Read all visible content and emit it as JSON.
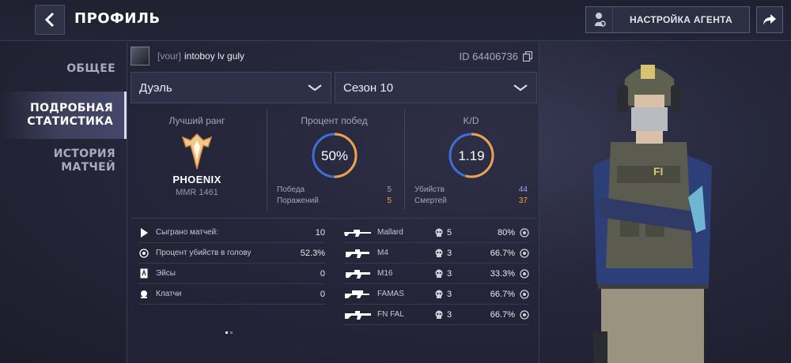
{
  "header": {
    "title": "ПРОФИЛЬ",
    "agent_button_label": "НАСТРОЙКА АГЕНТА"
  },
  "nav": {
    "items": [
      {
        "label": "ОБЩЕЕ",
        "active": false
      },
      {
        "label": "ПОДРОБНАЯ СТАТИСТИКА",
        "active": true
      },
      {
        "label": "ИСТОРИЯ МАТЧЕЙ",
        "active": false
      }
    ]
  },
  "user": {
    "clan": "[vour]",
    "nickname": "intoboy lv guly",
    "id_text": "ID 64406736"
  },
  "filters": {
    "mode": "Дуэль",
    "season": "Сезон 10"
  },
  "rank": {
    "title": "Лучший ранг",
    "name": "PHOENIX",
    "mmr": "MMR 1461"
  },
  "winrate": {
    "title": "Процент побед",
    "value_text": "50%",
    "fraction": 0.5,
    "wins_label": "Победа",
    "wins": "5",
    "losses_label": "Поражений",
    "losses": "5"
  },
  "kd": {
    "title": "K/D",
    "value_text": "1.19",
    "fraction": 0.543,
    "kills_label": "Убийств",
    "kills": "44",
    "deaths_label": "Смертей",
    "deaths": "37"
  },
  "stats": [
    {
      "icon": "play-icon",
      "label": "Сыграно матчей:",
      "value": "10"
    },
    {
      "icon": "headshot-icon",
      "label": "Процент убийств в голову",
      "value": "52.3%"
    },
    {
      "icon": "ace-card-icon",
      "label": "Эйсы",
      "value": "0"
    },
    {
      "icon": "clutch-icon",
      "label": "Клатчи",
      "value": "0"
    }
  ],
  "weapons": [
    {
      "name": "Mallard",
      "kills": "5",
      "hs": "80%"
    },
    {
      "name": "M4",
      "kills": "3",
      "hs": "66.7%"
    },
    {
      "name": "M16",
      "kills": "3",
      "hs": "33.3%"
    },
    {
      "name": "FAMAS",
      "kills": "3",
      "hs": "66.7%"
    },
    {
      "name": "FN FAL",
      "kills": "3",
      "hs": "66.7%"
    }
  ],
  "colors": {
    "accent_orange": "#f0a24a",
    "accent_blue": "#3e6fd6",
    "background": "#26273a"
  }
}
